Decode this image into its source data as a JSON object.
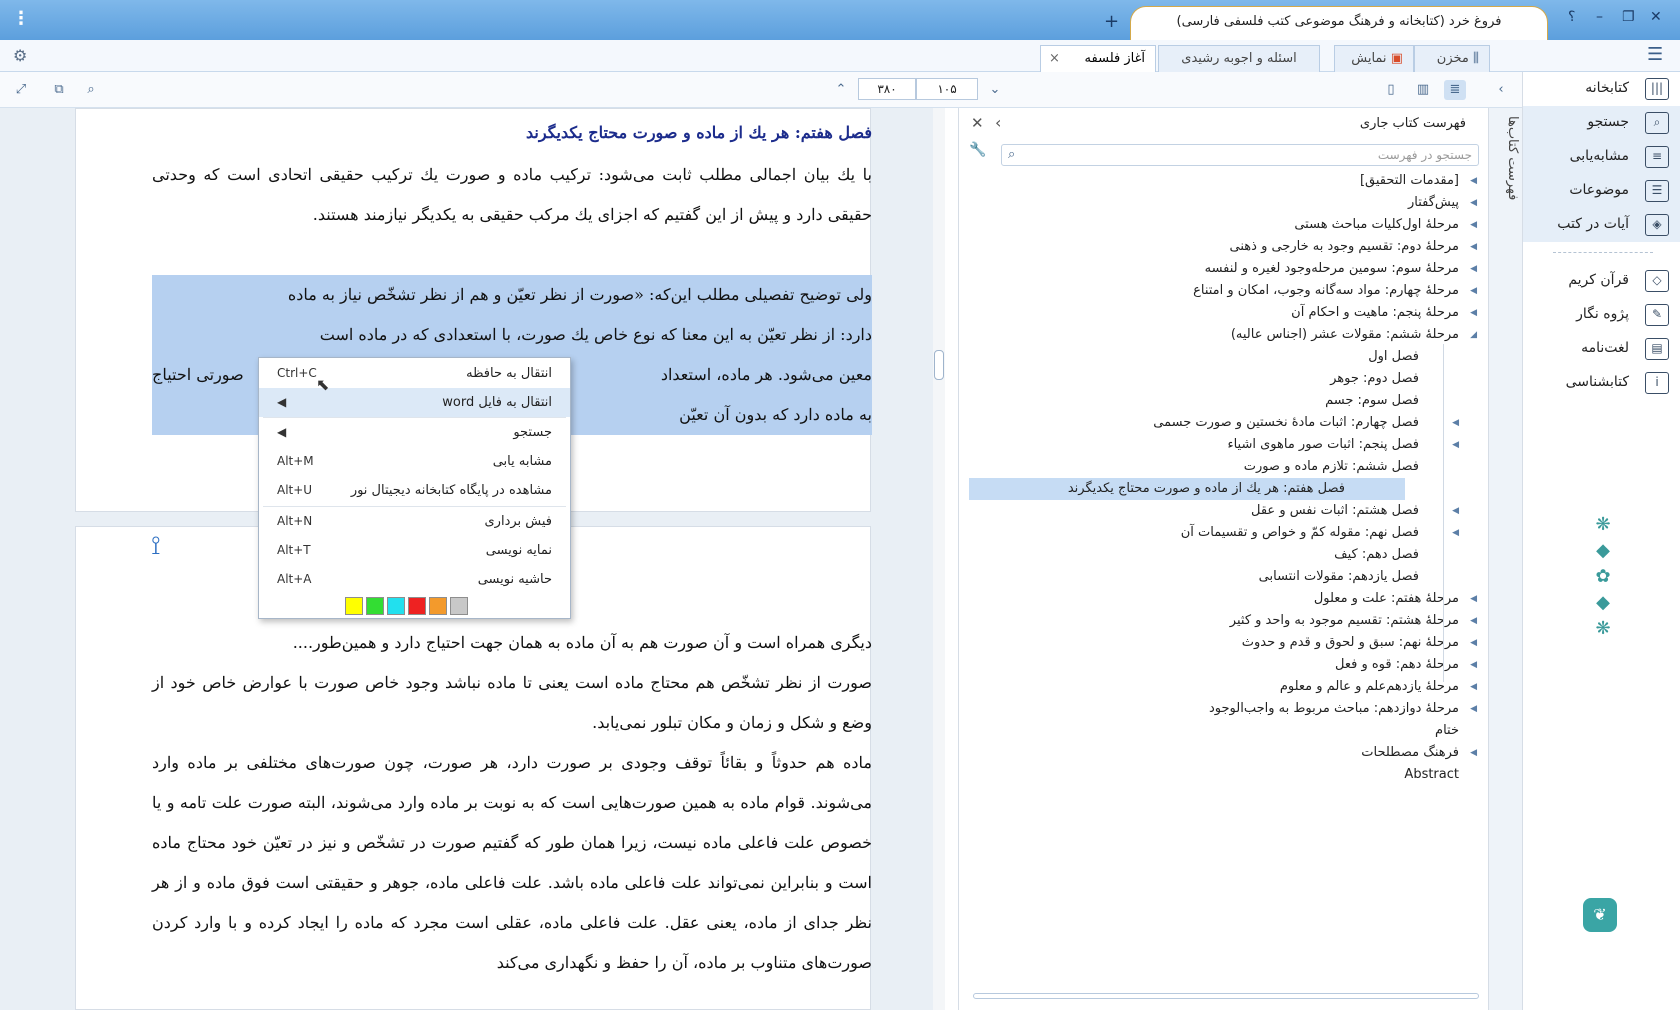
{
  "window": {
    "title": "فروغ خرد (کتابخانه و فرهنگ موضوعی کتب فلسفی فارسی)",
    "help": "؟",
    "minimize": "–",
    "restore": "❐",
    "close": "✕",
    "new_tab": "+",
    "menu": "⋮"
  },
  "tabs": [
    {
      "label": "مخزن"
    },
    {
      "label": "نمایش"
    },
    {
      "label": "اسئله و اجوبه رشیدی"
    },
    {
      "label": "آغاز فلسفه",
      "close": "×"
    }
  ],
  "toolbar": {
    "page_current": "۱۰۵",
    "page_total": "۳۸۰",
    "prev": "⌄",
    "next": "⌃"
  },
  "reader": {
    "page1": {
      "heading": "فصل هفتم: هر يك از ماده و صورت محتاج يكديگرند",
      "para1": "با يك بيان اجمالى مطلب ثابت مى‌شود: تركيب ماده و صورت يك تركيب حقيقى اتحادى است كه وحدتى حقيقى دارد و پيش از اين گفتيم كه اجزاى يك مركب حقيقى به يكديگر نيازمند هستند.",
      "para2_l1": "ولى توضيح تفصيلى مطلب اين‌كه: «صورت از نظر تعيّن و هم از نظر تشخّص نياز به ماده",
      "para2_l2": "دارد: از نظر تعيّن به اين معنا كه نوع خاص يك صورت، با استعدادى كه در ماده است",
      "para2_l3": "معين مى‌شود. هر ماده، استعداد",
      "para2_l3b": "صورتى احتياج",
      "para2_l4": "به ماده دارد كه بدون آن تعيّن"
    },
    "page2": {
      "para1": "ديگرى همراه است و آن صورت هم به آن ماده به همان جهت احتياج دارد و همين‌طور....",
      "para2": "صورت از نظر تشخّص هم محتاج ماده است يعنى تا ماده نباشد وجود خاص صورت با عوارض خاص خود از وضع و شكل و زمان و مكان تبلور نمى‌يابد.",
      "para3": "ماده هم حدوثاً و بقائاً توقف وجودى بر صورت دارد، هر صورت، چون صورت‌هاى مختلفى بر ماده وارد مى‌شوند. قوام ماده به همين صورت‌هايى است كه به نوبت بر ماده وارد مى‌شوند، البته صورت علت تامه و يا خصوص علت فاعلى ماده نيست، زيرا همان طور كه گفتيم صورت در تشخّص و نيز در تعيّن خود محتاج ماده است و بنابراين نمى‌تواند علت فاعلى ماده باشد. علت فاعلى ماده، جوهر و حقيقتى است فوق ماده و از هر نظر جداى از ماده، يعنى عقل. علت فاعلى ماده، عقلى است مجرد كه ماده را ايجاد كرده و با وارد كردن صورت‌هاى متناوب بر ماده، آن را حفظ و نگهدارى مى‌كند"
    }
  },
  "context_menu": {
    "items": [
      {
        "label": "انتقال به حافظه",
        "shortcut": "Ctrl+C"
      },
      {
        "label": "انتقال به فایل word",
        "shortcut": "◀"
      },
      {
        "label": "جستجو",
        "shortcut": "◀"
      },
      {
        "label": "مشابه یابی",
        "shortcut": "Alt+M"
      },
      {
        "label": "مشاهده در پایگاه کتابخانه دیجیتال نور",
        "shortcut": "Alt+U"
      },
      {
        "label": "فیش برداری",
        "shortcut": "Alt+N"
      },
      {
        "label": "نمایه نویسی",
        "shortcut": "Alt+T"
      },
      {
        "label": "حاشیه نویسی",
        "shortcut": "Alt+A"
      }
    ],
    "swatches": [
      "#ffff00",
      "#33dd33",
      "#22e0ee",
      "#ee2222",
      "#f39a2c",
      "#c8c8c8"
    ]
  },
  "toc": {
    "title": "فهرست کتاب جاری",
    "search_placeholder": "جستجو در فهرست",
    "items": [
      {
        "label": "[مقدمات التحقيق]",
        "indent": 0,
        "arrow": "◀"
      },
      {
        "label": "پيش‌گفتار",
        "indent": 0,
        "arrow": "◀"
      },
      {
        "label": "مرحلهٔ اول‌كليات مباحث هستى",
        "indent": 0,
        "arrow": "◀"
      },
      {
        "label": "مرحلهٔ دوم: تقسيم وجود به خارجى و ذهنى",
        "indent": 0,
        "arrow": "◀"
      },
      {
        "label": "مرحلهٔ سوم: سومين مرحله‌وجود لغيره و لنفسه",
        "indent": 0,
        "arrow": "◀"
      },
      {
        "label": "مرحلهٔ چهارم: مواد سه‌گانه وجوب، امكان و امتناع",
        "indent": 0,
        "arrow": "◀"
      },
      {
        "label": "مرحلهٔ پنجم: ماهيت و احكام آن",
        "indent": 0,
        "arrow": "◀"
      },
      {
        "label": "مرحلهٔ ششم: مقولات عشر (اجناس عاليه)",
        "indent": 0,
        "arrow": "◢"
      },
      {
        "label": "فصل اول",
        "indent": 1,
        "arrow": ""
      },
      {
        "label": "فصل دوم: جوهر",
        "indent": 1,
        "arrow": ""
      },
      {
        "label": "فصل سوم: جسم",
        "indent": 1,
        "arrow": ""
      },
      {
        "label": "فصل چهارم: اثبات مادهٔ نخستين و صورت جسمى",
        "indent": 1,
        "arrow": "◀"
      },
      {
        "label": "فصل پنجم: اثبات صور ماهوى اشياء",
        "indent": 1,
        "arrow": "◀"
      },
      {
        "label": "فصل ششم: تلازم ماده و صورت",
        "indent": 1,
        "arrow": ""
      },
      {
        "label": "فصل هفتم: هر يك از ماده و صورت محتاج يكديگرند",
        "indent": 1,
        "arrow": "",
        "selected": true
      },
      {
        "label": "فصل هشتم: اثبات نفس و عقل",
        "indent": 1,
        "arrow": "◀"
      },
      {
        "label": "فصل نهم: مقوله كمّ و خواص و تقسيمات آن",
        "indent": 1,
        "arrow": "◀"
      },
      {
        "label": "فصل دهم: كيف",
        "indent": 1,
        "arrow": ""
      },
      {
        "label": "فصل يازدهم: مقولات انتسابى",
        "indent": 1,
        "arrow": ""
      },
      {
        "label": "مرحلهٔ هفتم: علت و معلول",
        "indent": 0,
        "arrow": "◀"
      },
      {
        "label": "مرحلهٔ هشتم: تقسيم موجود به واحد و كثير",
        "indent": 0,
        "arrow": "◀"
      },
      {
        "label": "مرحلهٔ نهم: سبق و لحوق و قدم و حدوث",
        "indent": 0,
        "arrow": "◀"
      },
      {
        "label": "مرحلهٔ دهم: قوه و فعل",
        "indent": 0,
        "arrow": "◀"
      },
      {
        "label": "مرحلهٔ يازدهم‌علم و عالم و معلوم",
        "indent": 0,
        "arrow": "◀"
      },
      {
        "label": "مرحلهٔ دوازدهم: مباحث مربوط به واجب‌الوجود",
        "indent": 0,
        "arrow": "◀"
      },
      {
        "label": "ختام",
        "indent": 0,
        "arrow": ""
      },
      {
        "label": "فرهنگ مصطلحات",
        "indent": 0,
        "arrow": "◀"
      },
      {
        "label": "Abstract",
        "indent": 0,
        "arrow": ""
      }
    ]
  },
  "vertical_tab": {
    "label": "فهرست کتاب‌ها"
  },
  "nav": {
    "items": [
      {
        "label": "کتابخانه",
        "icon": "library-icon",
        "glyph": "|||"
      },
      {
        "label": "جستجو",
        "icon": "search-icon",
        "glyph": "⌕"
      },
      {
        "label": "مشابه‌یابی",
        "icon": "similar-icon",
        "glyph": "≡"
      },
      {
        "label": "موضوعات",
        "icon": "topics-icon",
        "glyph": "☰"
      },
      {
        "label": "آیات در کتب",
        "icon": "verses-icon",
        "glyph": "◈"
      },
      {
        "label": "قرآن کریم",
        "icon": "quran-icon",
        "glyph": "◇"
      },
      {
        "label": "پژوه نگار",
        "icon": "notes-icon",
        "glyph": "✎"
      },
      {
        "label": "لغت‌نامه",
        "icon": "dictionary-icon",
        "glyph": "▤"
      },
      {
        "label": "کتابشناسی",
        "icon": "bibliography-icon",
        "glyph": "i"
      }
    ]
  }
}
